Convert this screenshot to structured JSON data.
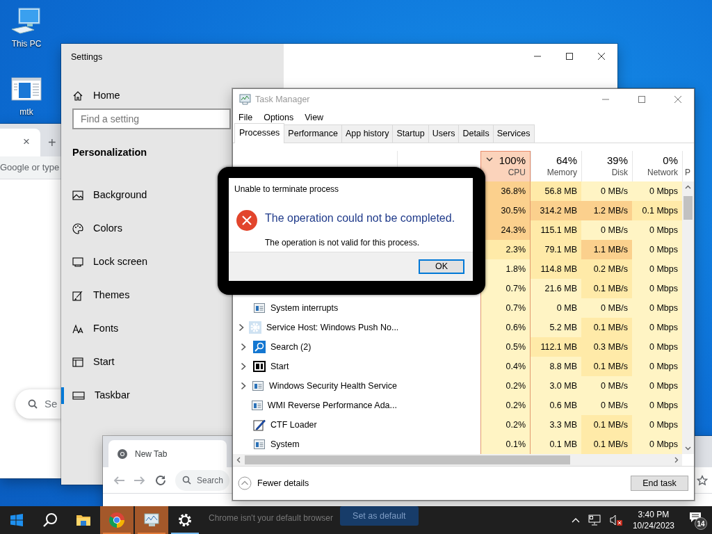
{
  "desktop": {
    "icons": [
      {
        "label": "This PC",
        "kind": "computer"
      },
      {
        "label": "mtk",
        "kind": "document"
      }
    ]
  },
  "chrome_back": {
    "tab_close": "×",
    "new_tab": "+",
    "omnibox_text": "Google or type",
    "search_text": "Se"
  },
  "settings": {
    "title": "Settings",
    "home": "Home",
    "search": {
      "placeholder": "Find a setting"
    },
    "section": "Personalization",
    "items": [
      {
        "label": "Background",
        "kind": "background",
        "selected": false
      },
      {
        "label": "Colors",
        "kind": "colors",
        "selected": false
      },
      {
        "label": "Lock screen",
        "kind": "lock",
        "selected": false
      },
      {
        "label": "Themes",
        "kind": "themes",
        "selected": false
      },
      {
        "label": "Fonts",
        "kind": "fonts",
        "selected": false
      },
      {
        "label": "Start",
        "kind": "start",
        "selected": false
      },
      {
        "label": "Taskbar",
        "kind": "taskbar",
        "selected": true
      }
    ]
  },
  "chrome_front": {
    "tab_title": "New Tab",
    "omnibox_placeholder": "Search",
    "infobar": {
      "message": "Chrome isn't your default browser",
      "button": "Set as default"
    }
  },
  "task_manager": {
    "title": "Task Manager",
    "menu": [
      "File",
      "Options",
      "View"
    ],
    "tabs": [
      {
        "label": "Processes",
        "selected": true
      },
      {
        "label": "Performance",
        "selected": false
      },
      {
        "label": "App history",
        "selected": false
      },
      {
        "label": "Startup",
        "selected": false
      },
      {
        "label": "Users",
        "selected": false
      },
      {
        "label": "Details",
        "selected": false
      },
      {
        "label": "Services",
        "selected": false
      }
    ],
    "columns": [
      {
        "percent": "100%",
        "label": "CPU",
        "sorted": true
      },
      {
        "percent": "64%",
        "label": "Memory",
        "sorted": false
      },
      {
        "percent": "39%",
        "label": "Disk",
        "sorted": false
      },
      {
        "percent": "0%",
        "label": "Network",
        "sorted": false
      }
    ],
    "column_5": "P",
    "processes": [
      {
        "cpu": "36.8%",
        "memory": "56.8 MB",
        "disk": "0 MB/s",
        "network": "0 Mbps"
      },
      {
        "cpu": "30.5%",
        "memory": "314.2 MB",
        "disk": "1.2 MB/s",
        "network": "0.1 Mbps"
      },
      {
        "cpu": "24.3%",
        "memory": "115.1 MB",
        "disk": "0 MB/s",
        "network": "0 Mbps"
      },
      {
        "cpu": "2.3%",
        "memory": "79.1 MB",
        "disk": "1.1 MB/s",
        "network": "0 Mbps"
      },
      {
        "cpu": "1.8%",
        "memory": "114.8 MB",
        "disk": "0.2 MB/s",
        "network": "0 Mbps"
      },
      {
        "cpu": "0.7%",
        "memory": "21.6 MB",
        "disk": "0.1 MB/s",
        "network": "0 Mbps"
      },
      {
        "name": "System interrupts",
        "kind": "window",
        "expandable": false,
        "cpu": "0.7%",
        "memory": "0 MB",
        "disk": "0 MB/s",
        "network": "0 Mbps"
      },
      {
        "name": "Service Host: Windows Push No...",
        "kind": "gear",
        "expandable": true,
        "cpu": "0.6%",
        "memory": "5.2 MB",
        "disk": "0.1 MB/s",
        "network": "0 Mbps"
      },
      {
        "name": "Search (2)",
        "kind": "search",
        "expandable": true,
        "cpu": "0.5%",
        "memory": "112.1 MB",
        "disk": "0.3 MB/s",
        "network": "0 Mbps"
      },
      {
        "name": "Start",
        "kind": "start",
        "expandable": true,
        "cpu": "0.4%",
        "memory": "8.8 MB",
        "disk": "0.1 MB/s",
        "network": "0 Mbps"
      },
      {
        "name": "Windows Security Health Service",
        "kind": "window",
        "expandable": true,
        "cpu": "0.2%",
        "memory": "3.0 MB",
        "disk": "0 MB/s",
        "network": "0 Mbps"
      },
      {
        "name": "WMI Reverse Performance Ada...",
        "kind": "window",
        "expandable": false,
        "cpu": "0.2%",
        "memory": "0.6 MB",
        "disk": "0 MB/s",
        "network": "0 Mbps"
      },
      {
        "name": "CTF Loader",
        "kind": "pen",
        "expandable": false,
        "cpu": "0.2%",
        "memory": "3.3 MB",
        "disk": "0.1 MB/s",
        "network": "0 Mbps"
      },
      {
        "name": "System",
        "kind": "window",
        "expandable": false,
        "cpu": "0.1%",
        "memory": "0.1 MB",
        "disk": "0.1 MB/s",
        "network": "0 Mbps"
      }
    ],
    "footer": {
      "fewer_details": "Fewer details",
      "end_task": "End task"
    }
  },
  "dialog": {
    "title": "Unable to terminate process",
    "heading": "The operation could not be completed.",
    "message": "The operation is not valid for this process.",
    "button": "OK"
  },
  "taskbar": {
    "apps": [
      {
        "kind": "start",
        "highlighted": false,
        "running": false
      },
      {
        "kind": "search",
        "highlighted": false,
        "running": false
      },
      {
        "kind": "explorer",
        "highlighted": false,
        "running": false
      },
      {
        "kind": "chrome",
        "highlighted": true,
        "running": true
      },
      {
        "kind": "taskmgr",
        "highlighted": true,
        "running": true
      },
      {
        "kind": "settings",
        "highlighted": false,
        "running": true
      }
    ],
    "tray": {
      "muted": true,
      "time": "3:40 PM",
      "date": "10/24/2023",
      "notifications": "14"
    }
  }
}
